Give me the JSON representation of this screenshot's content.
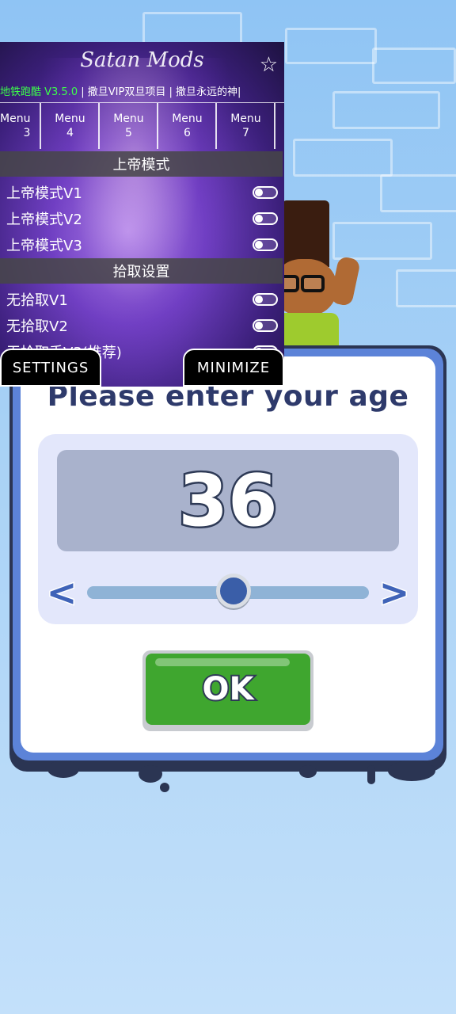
{
  "game": {
    "age_prompt": {
      "title": "Please enter your age",
      "age_value": "36",
      "slider_fraction": 0.52,
      "prev_icon": "<",
      "next_icon": ">",
      "ok_label": "OK"
    }
  },
  "mod_menu": {
    "title": "Satan Mods",
    "star_icon": "☆",
    "marquee_green": "地铁跑酷 V3.5.0",
    "marquee_white": " | 撒旦VIP双旦项目 | 撒旦永远的神|",
    "tabs": [
      {
        "line1": "Menu",
        "line2": "3"
      },
      {
        "line1": "Menu",
        "line2": "4"
      },
      {
        "line1": "Menu",
        "line2": "5"
      },
      {
        "line1": "Menu",
        "line2": "6"
      },
      {
        "line1": "Menu",
        "line2": "7"
      }
    ],
    "section1": "上帝模式",
    "section1_items": [
      "上帝模式V1",
      "上帝模式V2",
      "上帝模式V3"
    ],
    "section2": "拾取设置",
    "section2_items": [
      "无拾取V1",
      "无拾取V2",
      "无拾取手V3(推荐)"
    ],
    "settings_label": "SETTINGS",
    "minimize_label": "MINIMIZE"
  },
  "colors": {
    "sky": "#8fc4f4",
    "dialog_border": "#2b3553",
    "dialog_frame": "#5c83d8",
    "ok_green": "#3fa62f",
    "title_navy": "#2e3a6b"
  }
}
